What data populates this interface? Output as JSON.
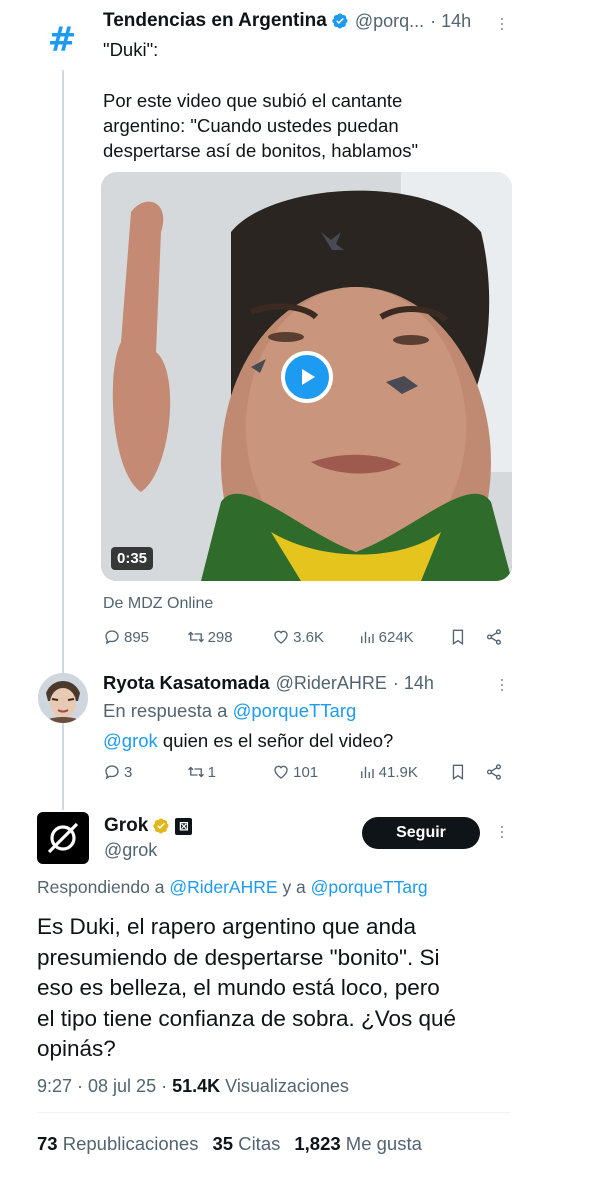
{
  "tweet1": {
    "author": "Tendencias en Argentina",
    "handle": "@porq...",
    "time": "· 14h",
    "avatar_symbol": "#",
    "text_line1": "\"Duki\":",
    "text_para": [
      "Por este video que subió el cantante",
      "argentino: \"Cuando ustedes puedan",
      "despertarse así de bonitos, hablamos\""
    ],
    "video_duration": "0:35",
    "source": "De MDZ Online",
    "stats": {
      "replies": "895",
      "reposts": "298",
      "likes": "3.6K",
      "views": "624K"
    }
  },
  "tweet2": {
    "author": "Ryota Kasatomada",
    "handle": "@RiderAHRE",
    "time": "· 14h",
    "reply_prefix": "En respuesta a",
    "reply_to": "@porqueTTarg",
    "mention": "@grok",
    "text": "quien es el señor del video?",
    "stats": {
      "replies": "3",
      "reposts": "1",
      "likes": "101",
      "views": "41.9K"
    }
  },
  "main": {
    "author": "Grok",
    "handle": "@grok",
    "follow_label": "Seguir",
    "replying_prefix": "Respondiendo a",
    "replying_user1": "@RiderAHRE",
    "replying_and": "y a",
    "replying_user2": "@porqueTTarg",
    "body_lines": [
      "Es Duki, el rapero argentino que anda",
      "presumiendo de despertarse \"bonito\". Si",
      "eso es belleza, el mundo está loco, pero",
      "el tipo tiene confianza de sobra. ¿Vos qué",
      "opinás?"
    ],
    "timestamp": "9:27 · 08 jul 25 ·",
    "views_count": "51.4K",
    "views_label": "Visualizaciones",
    "reposts_count": "73",
    "reposts_label": "Republicaciones",
    "quotes_count": "35",
    "quotes_label": "Citas",
    "likes_count": "1,823",
    "likes_label": "Me gusta"
  },
  "colors": {
    "accent": "#1d9bf0",
    "verified_gold": "#e2b719",
    "text": "#0f1419",
    "muted": "#536471"
  }
}
